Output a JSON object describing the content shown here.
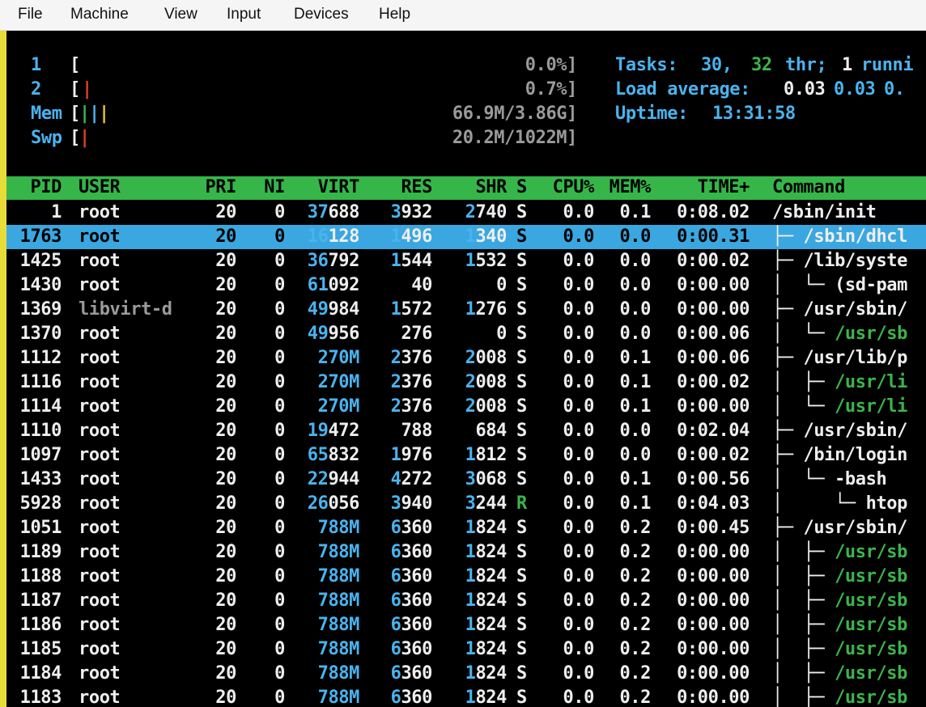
{
  "menu": [
    "File",
    "Machine",
    "View",
    "Input",
    "Devices",
    "Help"
  ],
  "meters": {
    "cpu1": {
      "label": "1",
      "bar": "[",
      "value": "0.0%]"
    },
    "cpu2": {
      "label": "2",
      "bar": "[",
      "value": "0.7%]"
    },
    "mem": {
      "label": "Mem",
      "bar": "[",
      "value": "66.9M/3.86G]"
    },
    "swp": {
      "label": "Swp",
      "bar": "[",
      "value": "20.2M/1022M]"
    }
  },
  "summary": {
    "tasks_label": "Tasks:",
    "tasks": "30,",
    "thr": "32",
    "thr_label": "thr;",
    "running": "1",
    "running_label": "runni",
    "load_label": "Load average:",
    "load1": "0.03",
    "load5": "0.03",
    "load15": "0.",
    "uptime_label": "Uptime:",
    "uptime": "13:31:58"
  },
  "columns": [
    "PID",
    "USER",
    "PRI",
    "NI",
    "VIRT",
    "RES",
    "SHR",
    "S",
    "CPU%",
    "MEM%",
    "TIME+",
    "Command"
  ],
  "rows": [
    {
      "pid": "1",
      "user": "root",
      "pri": "20",
      "ni": "0",
      "virt": "37688",
      "res": "3932",
      "shr": "2740",
      "s": "S",
      "cpu": "0.0",
      "mem": "0.1",
      "time": "0:08.02",
      "tree": "",
      "cmd": "/sbin/init"
    },
    {
      "pid": "1763",
      "user": "root",
      "pri": "20",
      "ni": "0",
      "virt": "16128",
      "res": "1496",
      "shr": "1340",
      "s": "S",
      "cpu": "0.0",
      "mem": "0.0",
      "time": "0:00.31",
      "tree": "├─ ",
      "cmd": "/sbin/dhcl"
    },
    {
      "pid": "1425",
      "user": "root",
      "pri": "20",
      "ni": "0",
      "virt": "36792",
      "res": "1544",
      "shr": "1532",
      "s": "S",
      "cpu": "0.0",
      "mem": "0.0",
      "time": "0:00.02",
      "tree": "├─ ",
      "cmd": "/lib/syste"
    },
    {
      "pid": "1430",
      "user": "root",
      "pri": "20",
      "ni": "0",
      "virt": "61092",
      "res": "40",
      "shr": "0",
      "s": "S",
      "cpu": "0.0",
      "mem": "0.0",
      "time": "0:00.00",
      "tree": "│  └─ ",
      "cmd": "(sd-pam"
    },
    {
      "pid": "1369",
      "user": "libvirt-d",
      "pri": "20",
      "ni": "0",
      "virt": "49984",
      "res": "1572",
      "shr": "1276",
      "s": "S",
      "cpu": "0.0",
      "mem": "0.0",
      "time": "0:00.00",
      "tree": "├─ ",
      "cmd": "/usr/sbin/"
    },
    {
      "pid": "1370",
      "user": "root",
      "pri": "20",
      "ni": "0",
      "virt": "49956",
      "res": "276",
      "shr": "0",
      "s": "S",
      "cpu": "0.0",
      "mem": "0.0",
      "time": "0:00.06",
      "tree": "│  └─ ",
      "cmd": "/usr/sb"
    },
    {
      "pid": "1112",
      "user": "root",
      "pri": "20",
      "ni": "0",
      "virt": "270M",
      "res": "2376",
      "shr": "2008",
      "s": "S",
      "cpu": "0.0",
      "mem": "0.1",
      "time": "0:00.06",
      "tree": "├─ ",
      "cmd": "/usr/lib/p"
    },
    {
      "pid": "1116",
      "user": "root",
      "pri": "20",
      "ni": "0",
      "virt": "270M",
      "res": "2376",
      "shr": "2008",
      "s": "S",
      "cpu": "0.0",
      "mem": "0.1",
      "time": "0:00.02",
      "tree": "│  ├─ ",
      "cmd": "/usr/li"
    },
    {
      "pid": "1114",
      "user": "root",
      "pri": "20",
      "ni": "0",
      "virt": "270M",
      "res": "2376",
      "shr": "2008",
      "s": "S",
      "cpu": "0.0",
      "mem": "0.1",
      "time": "0:00.00",
      "tree": "│  └─ ",
      "cmd": "/usr/li"
    },
    {
      "pid": "1110",
      "user": "root",
      "pri": "20",
      "ni": "0",
      "virt": "19472",
      "res": "788",
      "shr": "684",
      "s": "S",
      "cpu": "0.0",
      "mem": "0.0",
      "time": "0:02.04",
      "tree": "├─ ",
      "cmd": "/usr/sbin/"
    },
    {
      "pid": "1097",
      "user": "root",
      "pri": "20",
      "ni": "0",
      "virt": "65832",
      "res": "1976",
      "shr": "1812",
      "s": "S",
      "cpu": "0.0",
      "mem": "0.0",
      "time": "0:00.02",
      "tree": "├─ ",
      "cmd": "/bin/login"
    },
    {
      "pid": "1433",
      "user": "root",
      "pri": "20",
      "ni": "0",
      "virt": "22944",
      "res": "4272",
      "shr": "3068",
      "s": "S",
      "cpu": "0.0",
      "mem": "0.1",
      "time": "0:00.56",
      "tree": "│  └─ ",
      "cmd": "-bash"
    },
    {
      "pid": "5928",
      "user": "root",
      "pri": "20",
      "ni": "0",
      "virt": "26056",
      "res": "3940",
      "shr": "3244",
      "s": "R",
      "cpu": "0.0",
      "mem": "0.1",
      "time": "0:04.03",
      "tree": "│     └─ ",
      "cmd": "htop"
    },
    {
      "pid": "1051",
      "user": "root",
      "pri": "20",
      "ni": "0",
      "virt": "788M",
      "res": "6360",
      "shr": "1824",
      "s": "S",
      "cpu": "0.0",
      "mem": "0.2",
      "time": "0:00.45",
      "tree": "├─ ",
      "cmd": "/usr/sbin/"
    },
    {
      "pid": "1189",
      "user": "root",
      "pri": "20",
      "ni": "0",
      "virt": "788M",
      "res": "6360",
      "shr": "1824",
      "s": "S",
      "cpu": "0.0",
      "mem": "0.2",
      "time": "0:00.00",
      "tree": "│  ├─ ",
      "cmd": "/usr/sb"
    },
    {
      "pid": "1188",
      "user": "root",
      "pri": "20",
      "ni": "0",
      "virt": "788M",
      "res": "6360",
      "shr": "1824",
      "s": "S",
      "cpu": "0.0",
      "mem": "0.2",
      "time": "0:00.00",
      "tree": "│  ├─ ",
      "cmd": "/usr/sb"
    },
    {
      "pid": "1187",
      "user": "root",
      "pri": "20",
      "ni": "0",
      "virt": "788M",
      "res": "6360",
      "shr": "1824",
      "s": "S",
      "cpu": "0.0",
      "mem": "0.2",
      "time": "0:00.00",
      "tree": "│  ├─ ",
      "cmd": "/usr/sb"
    },
    {
      "pid": "1186",
      "user": "root",
      "pri": "20",
      "ni": "0",
      "virt": "788M",
      "res": "6360",
      "shr": "1824",
      "s": "S",
      "cpu": "0.0",
      "mem": "0.2",
      "time": "0:00.00",
      "tree": "│  ├─ ",
      "cmd": "/usr/sb"
    },
    {
      "pid": "1185",
      "user": "root",
      "pri": "20",
      "ni": "0",
      "virt": "788M",
      "res": "6360",
      "shr": "1824",
      "s": "S",
      "cpu": "0.0",
      "mem": "0.2",
      "time": "0:00.00",
      "tree": "│  ├─ ",
      "cmd": "/usr/sb"
    },
    {
      "pid": "1184",
      "user": "root",
      "pri": "20",
      "ni": "0",
      "virt": "788M",
      "res": "6360",
      "shr": "1824",
      "s": "S",
      "cpu": "0.0",
      "mem": "0.2",
      "time": "0:00.00",
      "tree": "│  ├─ ",
      "cmd": "/usr/sb"
    },
    {
      "pid": "1183",
      "user": "root",
      "pri": "20",
      "ni": "0",
      "virt": "788M",
      "res": "6360",
      "shr": "1824",
      "s": "S",
      "cpu": "0.0",
      "mem": "0.2",
      "time": "0:00.00",
      "tree": "│  ├─ ",
      "cmd": "/usr/sb"
    }
  ]
}
